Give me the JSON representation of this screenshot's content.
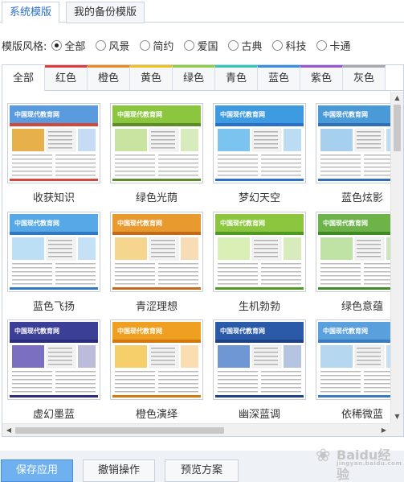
{
  "top_tabs": [
    {
      "label": "系统模版",
      "active": true
    },
    {
      "label": "我的备份模版",
      "active": false
    }
  ],
  "style_filter": {
    "label": "模版风格:",
    "options": [
      "全部",
      "风景",
      "简约",
      "爱国",
      "古典",
      "科技",
      "卡通"
    ],
    "selected": "全部"
  },
  "color_tabs": [
    {
      "label": "全部",
      "color": "#ffffff"
    },
    {
      "label": "红色",
      "color": "#e23a3a"
    },
    {
      "label": "橙色",
      "color": "#f08a1c"
    },
    {
      "label": "黄色",
      "color": "#f2c316"
    },
    {
      "label": "绿色",
      "color": "#8fcf3c"
    },
    {
      "label": "青色",
      "color": "#36c6b5"
    },
    {
      "label": "蓝色",
      "color": "#3a8de0"
    },
    {
      "label": "紫色",
      "color": "#9a55cf"
    },
    {
      "label": "灰色",
      "color": "#a8a8a8"
    }
  ],
  "templates": [
    {
      "name": "收获知识",
      "thumb_title": "中国现代教育网",
      "header": "#5a9be0",
      "banner": "#e8b04a",
      "accent": "#d4483a"
    },
    {
      "name": "绿色光荫",
      "thumb_title": "中国现代教育网",
      "header": "#8cc63f",
      "banner": "#c9e3a0",
      "accent": "#5e8c2a"
    },
    {
      "name": "梦幻天空",
      "thumb_title": "中国现代教育网",
      "header": "#3f9be0",
      "banner": "#7cc4f0",
      "accent": "#2a6fc9"
    },
    {
      "name": "蓝色炫影",
      "thumb_title": "中国现代教育网",
      "header": "#4a9ad8",
      "banner": "#a6d0ee",
      "accent": "#2e6fb5"
    },
    {
      "name": "蓝色飞扬",
      "thumb_title": "中国现代教育网",
      "header": "#56a8e6",
      "banner": "#bcdff5",
      "accent": "#2f78c2"
    },
    {
      "name": "青涩理想",
      "thumb_title": "中国现代教育网",
      "header": "#e89a2f",
      "banner": "#f6d58f",
      "accent": "#c26a18"
    },
    {
      "name": "生机勃勃",
      "thumb_title": "中国现代教育网",
      "header": "#8cc63f",
      "banner": "#d9efb5",
      "accent": "#4e9a22"
    },
    {
      "name": "绿色意蕴",
      "thumb_title": "中国现代教育网",
      "header": "#6db34a",
      "banner": "#bfe3a4",
      "accent": "#3f8a24"
    },
    {
      "name": "虚幻墨蓝",
      "thumb_title": "中国现代教育网",
      "header": "#3c3f96",
      "banner": "#7a6fc0",
      "accent": "#2b2e7a"
    },
    {
      "name": "橙色演绎",
      "thumb_title": "中国现代教育网",
      "header": "#f0a020",
      "banner": "#f6cf6a",
      "accent": "#d27a10"
    },
    {
      "name": "幽深蓝调",
      "thumb_title": "中国现代教育网",
      "header": "#2a5aa8",
      "banner": "#6f97d4",
      "accent": "#1e4283"
    },
    {
      "name": "依稀微蓝",
      "thumb_title": "中国现代教育网",
      "header": "#5aa0dc",
      "banner": "#b6d7f0",
      "accent": "#3a7cc0"
    }
  ],
  "buttons": {
    "save": "保存应用",
    "undo": "撤销操作",
    "preview": "预览方案"
  },
  "watermark": {
    "brand": "Baidu经验",
    "url": "jingyan.baidu.com"
  }
}
